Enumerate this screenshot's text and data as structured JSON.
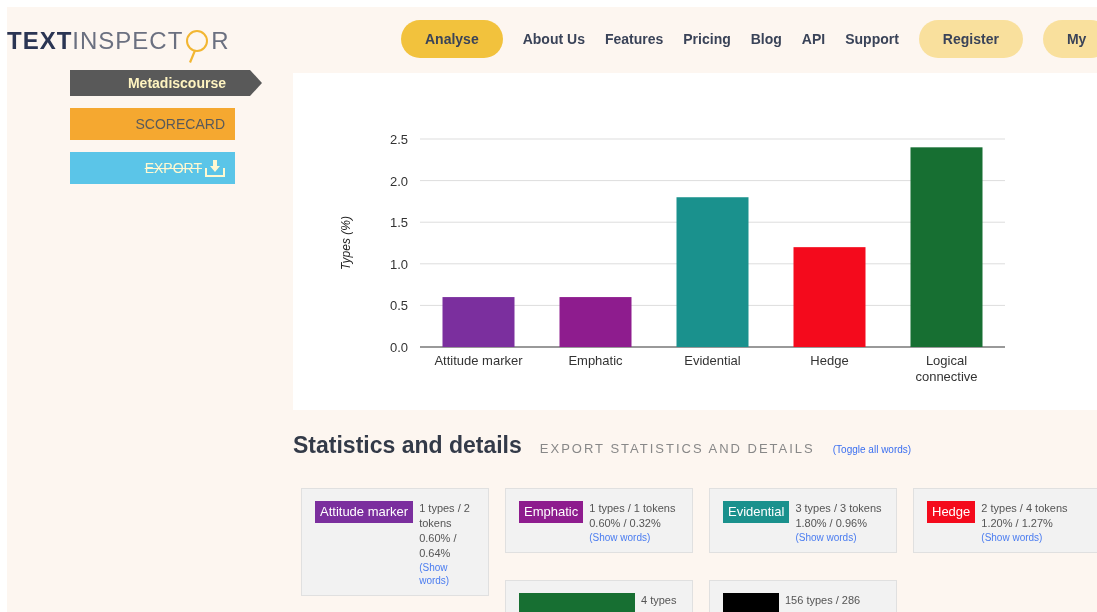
{
  "logo": {
    "bold": "TEXT",
    "light": "INSPECT",
    "end": "R"
  },
  "nav": [
    {
      "label": "Analyse",
      "kind": "pill",
      "selected": true
    },
    {
      "label": "About Us",
      "kind": "link",
      "selected": false
    },
    {
      "label": "Features",
      "kind": "link",
      "selected": false
    },
    {
      "label": "Pricing",
      "kind": "link",
      "selected": false
    },
    {
      "label": "Blog",
      "kind": "link",
      "selected": false
    },
    {
      "label": "API",
      "kind": "link",
      "selected": false
    },
    {
      "label": "Support",
      "kind": "link",
      "selected": false
    },
    {
      "label": "Register",
      "kind": "pill",
      "selected": false
    },
    {
      "label": "My",
      "kind": "pill",
      "selected": false
    }
  ],
  "sidebar": [
    {
      "label": "Metadiscourse",
      "kind": "current"
    },
    {
      "label": "SCORECARD",
      "kind": "scorecard"
    },
    {
      "label": "EXPORT",
      "kind": "export"
    }
  ],
  "chart_data": {
    "type": "bar",
    "ylabel": "Types (%)",
    "categories": [
      "Attitude marker",
      "Emphatic",
      "Evidential",
      "Hedge",
      "Logical connective"
    ],
    "grid": true,
    "series": [
      {
        "colors": [
          "#7b2f9e",
          "#8e1c8e",
          "#1a918d",
          "#f40a1c",
          "#176f32"
        ],
        "values": [
          0.6,
          0.6,
          1.8,
          1.2,
          2.4
        ]
      }
    ],
    "ylim": [
      0,
      2.5
    ],
    "yticks": [
      {
        "value": 0,
        "label": "0.0"
      },
      {
        "value": 0.5,
        "label": "0.5"
      },
      {
        "value": 1,
        "label": "1.0"
      },
      {
        "value": 1.5,
        "label": "1.5"
      },
      {
        "value": 2,
        "label": "2.0"
      },
      {
        "value": 2.5,
        "label": "2.5"
      }
    ]
  },
  "statistics": {
    "title": "Statistics and details",
    "export": "EXPORT STATISTICS AND DETAILS",
    "toggle": "(Toggle all words)",
    "cards": [
      {
        "label": "Attitude marker",
        "color": "#7b2f9e",
        "stats": "1 types / 2 tokens 0.60% / 0.64%",
        "link": "(Show words)"
      },
      {
        "label": "Emphatic",
        "color": "#8e1c8e",
        "stats": "1 types / 1 tokens 0.60% / 0.32%",
        "link": "(Show words)"
      },
      {
        "label": "Evidential",
        "color": "#1a918d",
        "stats": "3 types / 3 tokens 1.80% / 0.96%",
        "link": "(Show words)"
      },
      {
        "label": "Hedge",
        "color": "#f40a1c",
        "stats": "2 types / 4 tokens 1.20% / 1.27%",
        "link": "(Show words)"
      },
      {
        "color": "#176f32",
        "stats": "4 types"
      },
      {
        "color": "#000000",
        "stats": "156 types / 286"
      }
    ]
  }
}
